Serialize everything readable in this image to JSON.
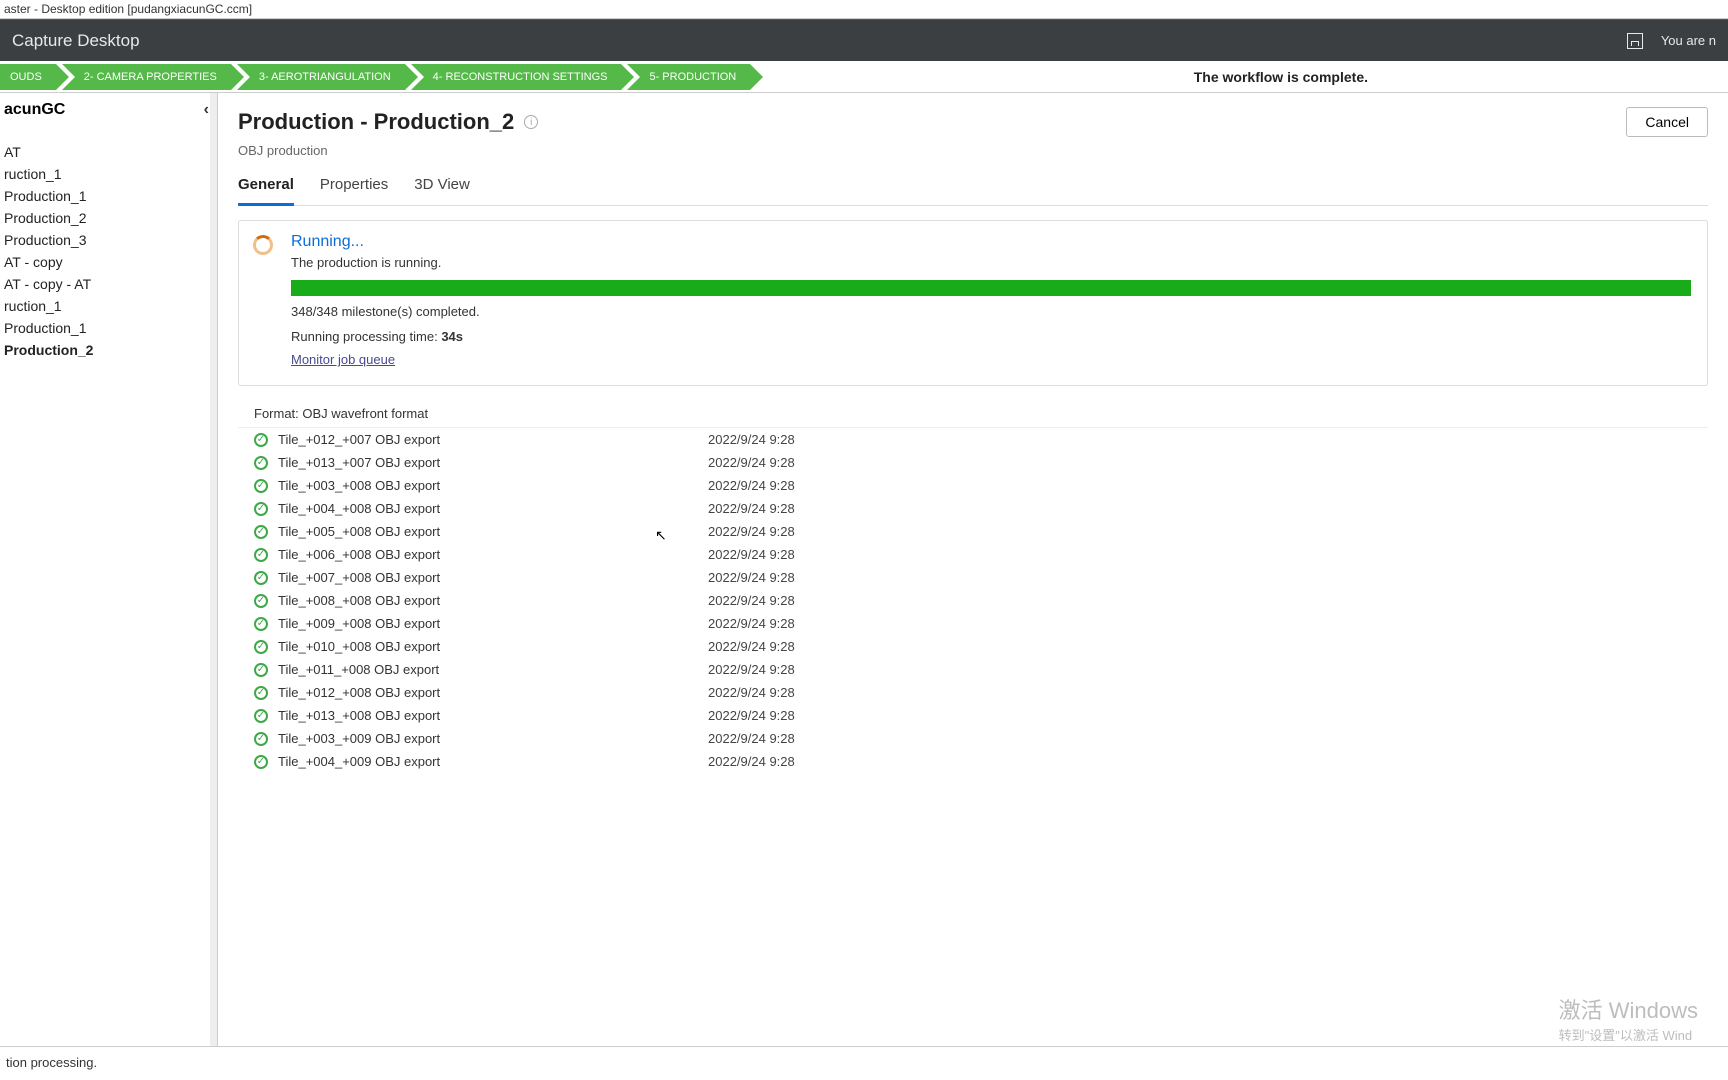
{
  "window_title": "aster - Desktop edition [pudangxiacunGC.ccm]",
  "app_name": "Capture Desktop",
  "header_right_text": "You are n",
  "workflow_message": "The workflow is complete.",
  "workflow_steps": [
    "OUDS",
    "2- CAMERA PROPERTIES",
    "3- AEROTRIANGULATION",
    "4- RECONSTRUCTION SETTINGS",
    "5- PRODUCTION"
  ],
  "sidebar": {
    "title": "acunGC",
    "items": [
      " AT",
      "ruction_1",
      "Production_1",
      "Production_2",
      "Production_3",
      " AT - copy",
      " AT - copy - AT",
      "ruction_1",
      "Production_1",
      "Production_2"
    ],
    "active_index": 9
  },
  "page": {
    "title": "Production - Production_2",
    "subtitle": "OBJ production",
    "cancel_label": "Cancel"
  },
  "tabs": {
    "items": [
      "General",
      "Properties",
      "3D View"
    ],
    "active_index": 0
  },
  "status": {
    "title": "Running...",
    "desc": "The production is running.",
    "milestones": "348/348 milestone(s) completed.",
    "runtime_label": "Running processing time: ",
    "runtime_value": "34s",
    "monitor_link": "Monitor job queue"
  },
  "format_row": "Format: OBJ wavefront format",
  "tiles": [
    {
      "name": "Tile_+012_+007 OBJ export",
      "date": "2022/9/24 9:28"
    },
    {
      "name": "Tile_+013_+007 OBJ export",
      "date": "2022/9/24 9:28"
    },
    {
      "name": "Tile_+003_+008 OBJ export",
      "date": "2022/9/24 9:28"
    },
    {
      "name": "Tile_+004_+008 OBJ export",
      "date": "2022/9/24 9:28"
    },
    {
      "name": "Tile_+005_+008 OBJ export",
      "date": "2022/9/24 9:28"
    },
    {
      "name": "Tile_+006_+008 OBJ export",
      "date": "2022/9/24 9:28"
    },
    {
      "name": "Tile_+007_+008 OBJ export",
      "date": "2022/9/24 9:28"
    },
    {
      "name": "Tile_+008_+008 OBJ export",
      "date": "2022/9/24 9:28"
    },
    {
      "name": "Tile_+009_+008 OBJ export",
      "date": "2022/9/24 9:28"
    },
    {
      "name": "Tile_+010_+008 OBJ export",
      "date": "2022/9/24 9:28"
    },
    {
      "name": "Tile_+011_+008 OBJ export",
      "date": "2022/9/24 9:28"
    },
    {
      "name": "Tile_+012_+008 OBJ export",
      "date": "2022/9/24 9:28"
    },
    {
      "name": "Tile_+013_+008 OBJ export",
      "date": "2022/9/24 9:28"
    },
    {
      "name": "Tile_+003_+009 OBJ export",
      "date": "2022/9/24 9:28"
    },
    {
      "name": "Tile_+004_+009 OBJ export",
      "date": "2022/9/24 9:28"
    }
  ],
  "status_bar": "tion processing.",
  "watermark": {
    "l1": "激活 Windows",
    "l2": "转到\"设置\"以激活 Wind"
  }
}
